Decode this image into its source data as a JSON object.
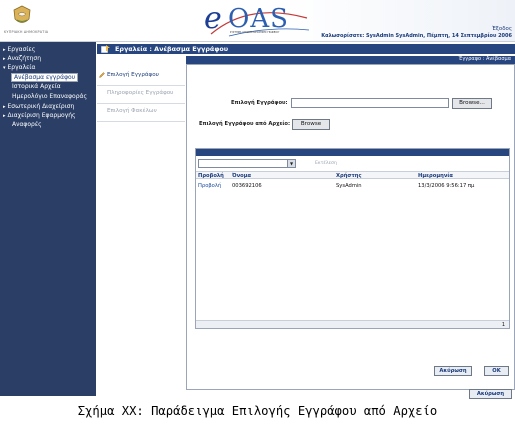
{
  "header": {
    "crest_caption": "ΚΥΠΡΙΑΚΗ ΔΗΜΟΚΡΑΤΙΑ",
    "logo_e": "e",
    "logo_text": "OAS",
    "logo_subtitle": "ΣΥΣΤΗΜΑ ΑΥΤΟΜΑΤΟΠΟΙΗΣΗΣ ΓΡΑΦΕΙΟΥ",
    "exit_label": "Έξοδος",
    "welcome_text": "Καλωσορίσατε: SysAdmin SysAdmin, Πέμπτη, 14 Σεπτεμβρίου 2006"
  },
  "sidebar": {
    "items": [
      {
        "label": "Εργασίες"
      },
      {
        "label": "Αναζήτηση"
      },
      {
        "label": "Εργαλεία"
      },
      {
        "label": "Ανέβασμα εγγράφου"
      },
      {
        "label": "Ιστορικά Αρχεία"
      },
      {
        "label": "Ημερολόγιο Επαναφοράς"
      },
      {
        "label": "Εσωτερική Διαχείριση"
      },
      {
        "label": "Διαχείριση Εφαρμογής"
      },
      {
        "label": "Αναφορές"
      }
    ]
  },
  "main": {
    "title": "Εργαλεία :  Ανέβασμα Εγγράφου",
    "subtitle": "Έγγραφο : Ανέβασμα",
    "tabs": [
      {
        "label": "Επιλογή Εγγράφου"
      },
      {
        "label": "Πληροφορίες Εγγράφου"
      },
      {
        "label": "Επιλογή Φακέλων"
      }
    ],
    "form": {
      "select_doc_label": "Επιλογή Εγγράφου:",
      "select_doc_value": "",
      "browse_label": "Browse...",
      "select_from_archive_label": "Επιλογή Εγγράφου από Αρχείο:",
      "browse2_label": "Browse"
    },
    "grid": {
      "filter_placeholder": "Εκτέλεση",
      "columns": [
        "Προβολή",
        "Όνομα",
        "Χρήστης",
        "Ημερομηνία"
      ],
      "rows": [
        {
          "view": "Προβολή",
          "name": "003692106",
          "user": "SysAdmin",
          "date": "13/3/2006 9:56:17 πμ"
        }
      ],
      "page": "1"
    },
    "cancel_label": "Ακύρωση",
    "ok_label": "OK",
    "outer_cancel_label": "Ακύρωση"
  },
  "caption": "Σχήμα ΧΧ: Παράδειγμα Επιλογής Εγγράφου από Αρχείο",
  "colors": {
    "navy": "#27467f",
    "sidebar": "#2a3e66",
    "link": "#1a4ba0"
  }
}
